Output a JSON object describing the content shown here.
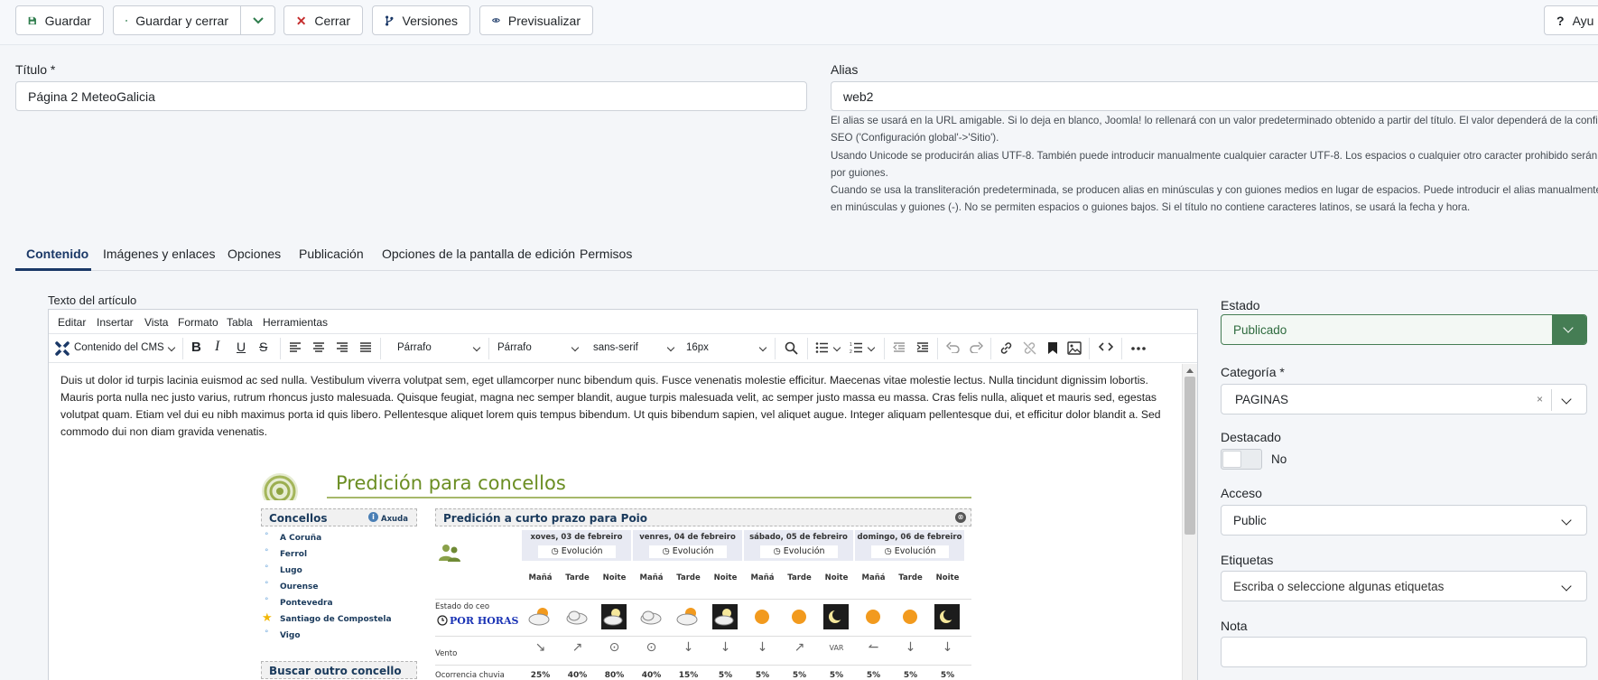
{
  "toolbar": {
    "save": "Guardar",
    "save_close": "Guardar y cerrar",
    "close": "Cerrar",
    "versions": "Versiones",
    "preview": "Previsualizar",
    "help": "Ayu"
  },
  "form": {
    "title_label": "Título *",
    "title_value": "Página 2 MeteoGalicia",
    "alias_label": "Alias",
    "alias_value": "web2",
    "alias_help": [
      "El alias se usará en la URL amigable. Si lo deja en blanco, Joomla! lo rellenará con un valor predeterminado obtenido a partir del título. El valor dependerá de la configuració",
      "SEO ('Configuración global'->'Sitio').",
      "Usando Unicode se producirán alias UTF-8. También puede introducir manualmente cualquier caracter UTF-8. Los espacios o cualquier otro caracter prohibido serán sustitu",
      "por guiones.",
      "Cuando se usa la transliteración predeterminada, se producen alias en minúsculas y con guiones medios en lugar de espacios. Puede introducir el alias manualmente. Use l",
      "en minúsculas y guiones (-). No se permiten espacios o guiones bajos. Si el título no contiene caracteres latinos, se usará la fecha y hora."
    ]
  },
  "tabs": [
    "Contenido",
    "Imágenes y enlaces",
    "Opciones",
    "Publicación",
    "Opciones de la pantalla de edición",
    "Permisos"
  ],
  "editor": {
    "label": "Texto del artículo",
    "menu": [
      "Editar",
      "Insertar",
      "Vista",
      "Formato",
      "Tabla",
      "Herramientas"
    ],
    "cms_content": "Contenido del CMS",
    "block_format_1": "Párrafo",
    "block_format_2": "Párrafo",
    "font_family": "sans-serif",
    "font_size": "16px",
    "body_text": "Duis ut dolor id turpis lacinia euismod ac sed nulla. Vestibulum viverra volutpat sem, eget ullamcorper nunc bibendum quis. Fusce venenatis molestie efficitur. Maecenas vitae molestie lectus. Nulla tincidunt dignissim lobortis. Mauris porta nulla nec justo varius, rutrum rhoncus justo malesuada. Quisque feugiat, magna nec semper blandit, augue turpis malesuada velit, ac semper justo massa eu massa. Cras felis nulla, aliquet et mauris sed, egestas volutpat quam. Etiam vel dui eu nibh maximus porta id quis libero. Pellentesque aliquet lorem quis tempus bibendum. Ut quis bibendum sapien, vel aliquet augue. Integer aliquam pellentesque dui, et efficitur dolor blandit a. Sed commodo dui non diam gravida venenatis."
  },
  "meteo": {
    "title": "Predición para concellos",
    "concellos_heading": "Concellos",
    "axuda": "Axuda",
    "concellos": [
      "A Coruña",
      "Ferrol",
      "Lugo",
      "Ourense",
      "Pontevedra",
      "Santiago de Compostela",
      "Vigo"
    ],
    "buscar": "Buscar outro concello",
    "forecast_heading": "Predición a curto prazo para Poio",
    "evolucion": "Evolución",
    "days": [
      "xoves, 03 de febreiro",
      "venres, 04 de febreiro",
      "sábado, 05 de febreiro",
      "domingo, 06 de febreiro"
    ],
    "periods": [
      "Mañá",
      "Tarde",
      "Noite"
    ],
    "estado_label": "Estado do ceo",
    "por_horas": "POR HORAS",
    "vento_label": "Vento",
    "vento_var": "VAR",
    "chuvia_label": "Ocorrencia chuvia",
    "chuvia": [
      "25%",
      "40%",
      "80%",
      "40%",
      "15%",
      "5%",
      "5%",
      "5%",
      "5%",
      "5%",
      "5%",
      "5%"
    ]
  },
  "sidebar": {
    "estado_label": "Estado",
    "estado_value": "Publicado",
    "categoria_label": "Categoría *",
    "categoria_value": "PAGINAS",
    "destacado_label": "Destacado",
    "destacado_value": "No",
    "acceso_label": "Acceso",
    "acceso_value": "Public",
    "etiquetas_label": "Etiquetas",
    "etiquetas_placeholder": "Escriba o seleccione algunas etiquetas",
    "nota_label": "Nota",
    "nota_value": ""
  },
  "colors": {
    "brand_blue": "#1a3867",
    "publish_green": "#457d54",
    "meteo_olive": "#6b8e23"
  }
}
